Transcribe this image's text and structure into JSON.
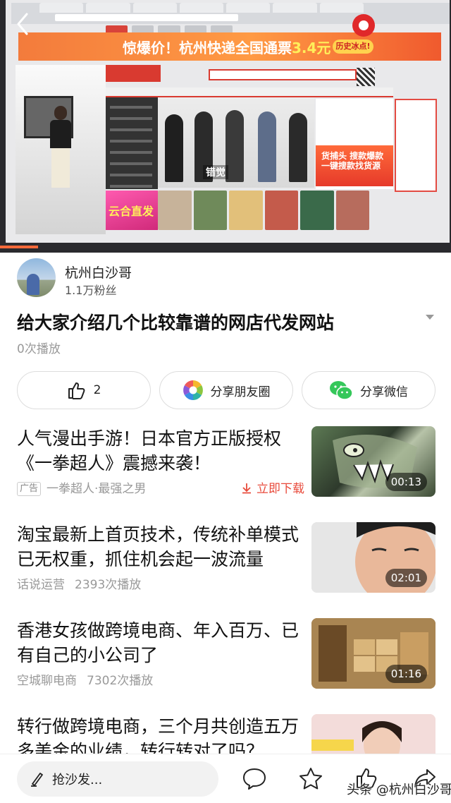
{
  "video": {
    "promo_text": "惊爆价！杭州快递全国通票",
    "promo_price": "3.4元",
    "promo_tag": "历史冰点!",
    "side_ad_text": "货捕头 搜款爆款 一键搜款找货源",
    "category_banner": "云合直发",
    "banner_caption": "错觉"
  },
  "author": {
    "name": "杭州白沙哥",
    "fans": "1.1万粉丝"
  },
  "video_info": {
    "title": "给大家介绍几个比较靠谱的网店代发网站",
    "play_count": "0次播放"
  },
  "actions": {
    "like_count": "2",
    "share_moments": "分享朋友圈",
    "share_wechat": "分享微信"
  },
  "feed": [
    {
      "title": "人气漫出手游！日本官方正版授权《一拳超人》震撼来袭！",
      "ad_label": "广告",
      "source": "一拳超人·最强之男",
      "download": "立即下载",
      "duration": "00:13"
    },
    {
      "title": "淘宝最新上首页技术，传统补单模式已无权重，抓住机会起一波流量",
      "source": "话说运营",
      "plays": "2393次播放",
      "duration": "02:01"
    },
    {
      "title": "香港女孩做跨境电商、年入百万、已有自己的小公司了",
      "source": "空城聊电商",
      "plays": "7302次播放",
      "duration": "01:16"
    },
    {
      "title": "转行做跨境电商，三个月共创造五万多美金的业绩，转行转对了吗？"
    }
  ],
  "bottom_bar": {
    "comment_placeholder": "抢沙发...",
    "watermark": "头条 @杭州白沙哥"
  },
  "colors": {
    "accent_red": "#e84a3b",
    "text_primary": "#111111",
    "text_secondary": "#999999"
  }
}
